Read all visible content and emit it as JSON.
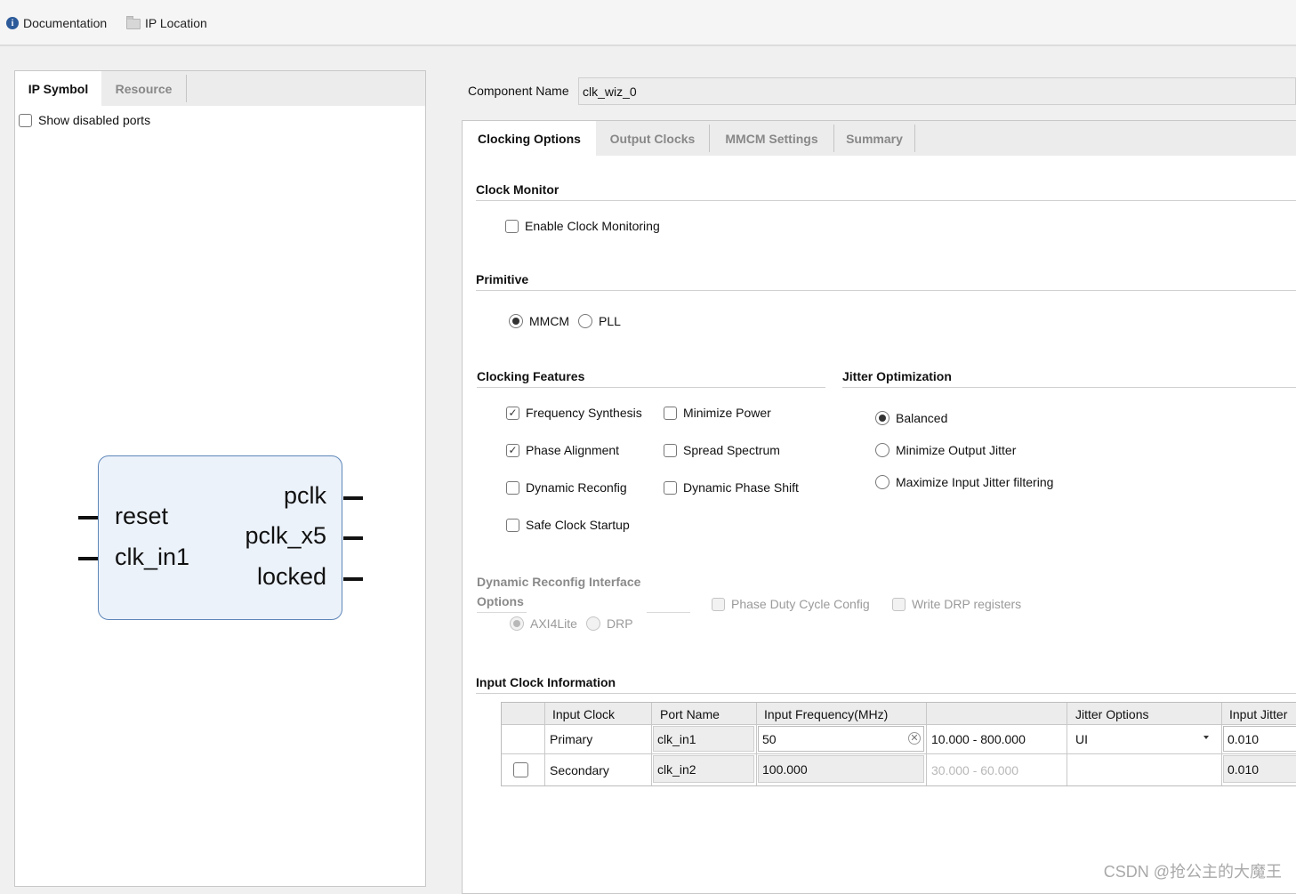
{
  "toolbar": {
    "documentation": "Documentation",
    "ip_location": "IP Location"
  },
  "left_panel": {
    "tabs": [
      "IP Symbol",
      "Resource"
    ],
    "active_tab": "IP Symbol",
    "show_disabled_ports": {
      "label": "Show disabled ports",
      "checked": false
    },
    "symbol": {
      "inputs": [
        "reset",
        "clk_in1"
      ],
      "outputs": [
        "pclk",
        "pclk_x5",
        "locked"
      ]
    }
  },
  "component": {
    "label": "Component Name",
    "value": "clk_wiz_0"
  },
  "tabs": [
    "Clocking Options",
    "Output Clocks",
    "MMCM Settings",
    "Summary"
  ],
  "active_tab": "Clocking Options",
  "clock_monitor": {
    "heading": "Clock Monitor",
    "enable": {
      "label": "Enable Clock Monitoring",
      "checked": false
    }
  },
  "primitive": {
    "heading": "Primitive",
    "options": [
      "MMCM",
      "PLL"
    ],
    "selected": "MMCM"
  },
  "clocking_features": {
    "heading": "Clocking Features",
    "frequency_synthesis": {
      "label": "Frequency Synthesis",
      "checked": true
    },
    "minimize_power": {
      "label": "Minimize Power",
      "checked": false
    },
    "phase_alignment": {
      "label": "Phase Alignment",
      "checked": true
    },
    "spread_spectrum": {
      "label": "Spread Spectrum",
      "checked": false
    },
    "dynamic_reconfig": {
      "label": "Dynamic Reconfig",
      "checked": false
    },
    "dynamic_phase_shift": {
      "label": "Dynamic Phase Shift",
      "checked": false
    },
    "safe_clock_startup": {
      "label": "Safe Clock Startup",
      "checked": false
    }
  },
  "jitter_optimization": {
    "heading": "Jitter Optimization",
    "options": [
      "Balanced",
      "Minimize Output Jitter",
      "Maximize Input Jitter filtering"
    ],
    "selected": "Balanced"
  },
  "dynamic_reconfig_interface": {
    "heading_line1": "Dynamic Reconfig Interface",
    "heading_line2": "Options",
    "options": [
      "AXI4Lite",
      "DRP"
    ],
    "selected": "AXI4Lite",
    "phase_duty_cycle_config": "Phase Duty Cycle Config",
    "write_drp_registers": "Write DRP registers"
  },
  "input_clock_info": {
    "heading": "Input Clock Information",
    "columns": [
      "Input Clock",
      "Port Name",
      "Input Frequency(MHz)",
      "",
      "Jitter Options",
      "Input Jitter"
    ],
    "rows": [
      {
        "clock": "Primary",
        "port": "clk_in1",
        "freq": "50",
        "range": "10.000 - 800.000",
        "jitter_option": "UI",
        "input_jitter": "0.010"
      },
      {
        "clock": "Secondary",
        "port": "clk_in2",
        "freq": "100.000",
        "range": "30.000 - 60.000",
        "jitter_option": "",
        "input_jitter": "0.010"
      }
    ]
  },
  "watermark": "CSDN @抢公主的大魔王"
}
